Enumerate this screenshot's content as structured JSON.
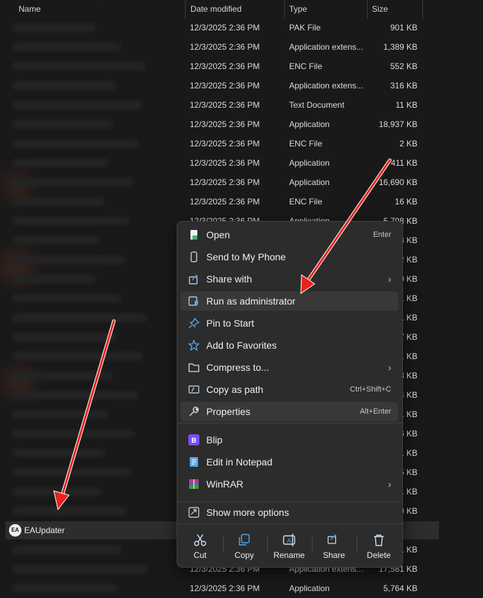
{
  "columns": {
    "name": "Name",
    "date": "Date modified",
    "type": "Type",
    "size": "Size"
  },
  "rows": [
    {
      "date": "12/3/2025 2:36 PM",
      "type": "PAK File",
      "size": "901 KB"
    },
    {
      "date": "12/3/2025 2:36 PM",
      "type": "Application extens...",
      "size": "1,389 KB"
    },
    {
      "date": "12/3/2025 2:36 PM",
      "type": "ENC File",
      "size": "552 KB"
    },
    {
      "date": "12/3/2025 2:36 PM",
      "type": "Application extens...",
      "size": "316 KB"
    },
    {
      "date": "12/3/2025 2:36 PM",
      "type": "Text Document",
      "size": "11 KB"
    },
    {
      "date": "12/3/2025 2:36 PM",
      "type": "Application",
      "size": "18,937 KB"
    },
    {
      "date": "12/3/2025 2:36 PM",
      "type": "ENC File",
      "size": "2 KB"
    },
    {
      "date": "12/3/2025 2:36 PM",
      "type": "Application",
      "size": "411 KB"
    },
    {
      "date": "12/3/2025 2:36 PM",
      "type": "Application",
      "size": "16,690 KB"
    },
    {
      "date": "12/3/2025 2:36 PM",
      "type": "ENC File",
      "size": "16 KB"
    },
    {
      "date": "12/3/2025 2:36 PM",
      "type": "Application",
      "size": "5,708 KB"
    },
    {
      "date": "",
      "type": "",
      "size": "3 KB"
    },
    {
      "date": "",
      "type": "",
      "size": "2 KB"
    },
    {
      "date": "",
      "type": "",
      "size": "0 KB"
    },
    {
      "date": "",
      "type": "",
      "size": "1 KB"
    },
    {
      "date": "",
      "type": "",
      "size": "1 KB"
    },
    {
      "date": "",
      "type": "",
      "size": "7 KB"
    },
    {
      "date": "",
      "type": "",
      "size": "1 KB"
    },
    {
      "date": "",
      "type": "",
      "size": "8 KB"
    },
    {
      "date": "",
      "type": "",
      "size": "4 KB"
    },
    {
      "date": "",
      "type": "",
      "size": "1 KB"
    },
    {
      "date": "",
      "type": "",
      "size": "6 KB"
    },
    {
      "date": "",
      "type": "",
      "size": "1 KB"
    },
    {
      "date": "",
      "type": "",
      "size": "5 KB"
    },
    {
      "date": "",
      "type": "",
      "size": "1 KB"
    },
    {
      "date": "",
      "type": "",
      "size": "9 KB"
    },
    {
      "date": "",
      "type": "",
      "size": "0 KB"
    },
    {
      "date": "",
      "type": "",
      "size": "1 KB"
    },
    {
      "date": "12/3/2025 2:36 PM",
      "type": "Application extens...",
      "size": "17,581 KB"
    },
    {
      "date": "12/3/2025 2:36 PM",
      "type": "Application",
      "size": "5,764 KB"
    }
  ],
  "selected_file": {
    "name": "EAUpdater",
    "icon_text": "EA"
  },
  "menu": {
    "items": [
      {
        "label": "Open",
        "shortcut": "Enter",
        "icon": "open-file-icon"
      },
      {
        "label": "Send to My Phone",
        "shortcut": "",
        "icon": "phone-icon"
      },
      {
        "label": "Share with",
        "shortcut": "",
        "icon": "share-icon"
      },
      {
        "label": "Run as administrator",
        "shortcut": "",
        "icon": "shield-icon"
      },
      {
        "label": "Pin to Start",
        "shortcut": "",
        "icon": "pin-icon"
      },
      {
        "label": "Add to Favorites",
        "shortcut": "",
        "icon": "star-icon"
      },
      {
        "label": "Compress to...",
        "shortcut": "",
        "icon": "zip-icon"
      },
      {
        "label": "Copy as path",
        "shortcut": "Ctrl+Shift+C",
        "icon": "copy-path-icon"
      },
      {
        "label": "Properties",
        "shortcut": "Alt+Enter",
        "icon": "wrench-icon"
      },
      {
        "label": "Blip",
        "shortcut": "",
        "icon": "blip-icon"
      },
      {
        "label": "Edit in Notepad",
        "shortcut": "",
        "icon": "notepad-icon"
      },
      {
        "label": "WinRAR",
        "shortcut": "",
        "icon": "winrar-icon"
      },
      {
        "label": "Show more options",
        "shortcut": "",
        "icon": "more-options-icon"
      }
    ],
    "quick_actions": [
      {
        "label": "Cut",
        "icon": "scissors-icon"
      },
      {
        "label": "Copy",
        "icon": "copy-icon"
      },
      {
        "label": "Rename",
        "icon": "rename-icon"
      },
      {
        "label": "Share",
        "icon": "share-icon"
      },
      {
        "label": "Delete",
        "icon": "trash-icon"
      }
    ]
  },
  "colors": {
    "background": "#191919",
    "menu": "#2c2c2c",
    "arrow": "#e8231d",
    "accent": "#5aa7e6"
  }
}
